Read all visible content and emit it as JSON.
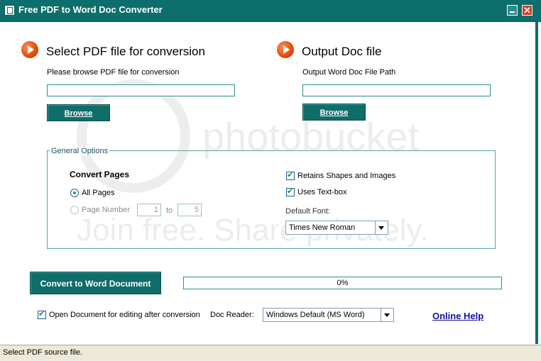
{
  "window": {
    "title": "Free PDF to Word Doc Converter",
    "icon": "app-icon",
    "controls": {
      "minimize": "minimize-icon",
      "close": "close-icon",
      "close_glyph": "✕"
    }
  },
  "input_section": {
    "heading": "Select PDF file for conversion",
    "description": "Please browse PDF file for conversion",
    "path_value": "",
    "browse_label": "Browse"
  },
  "output_section": {
    "heading": "Output Doc file",
    "description": "Output Word Doc File Path",
    "path_value": "",
    "browse_label": "Browse"
  },
  "general_options": {
    "label": "General Options",
    "convert_pages_title": "Convert Pages",
    "all_pages_label": "All Pages",
    "all_pages_selected": true,
    "page_number_label": "Page Number",
    "page_from": "1",
    "to_label": "to",
    "page_to": "5",
    "retain_shapes_label": "Retains Shapes and Images",
    "retain_shapes_checked": true,
    "use_textbox_label": "Uses Text-box",
    "use_textbox_checked": true,
    "default_font_label": "Default Font:",
    "default_font_value": "Times New Roman"
  },
  "actions": {
    "convert_label": "Convert to Word Document",
    "progress_text": "0%",
    "progress_fraction": 0
  },
  "footer": {
    "open_doc_label": "Open Document for editing after conversion",
    "open_doc_checked": true,
    "doc_reader_label": "Doc Reader:",
    "doc_reader_value": "Windows Default (MS Word)",
    "online_help_label": "Online Help"
  },
  "status": {
    "text": "Select PDF source file."
  },
  "watermark": {
    "line1": "photobucket",
    "line2": "Join free. Share privately."
  },
  "colors": {
    "title_bar": "#0d6f6c",
    "button": "#0f6d6a",
    "link": "#1010a0",
    "accent_arrow": "#e14d0c"
  }
}
